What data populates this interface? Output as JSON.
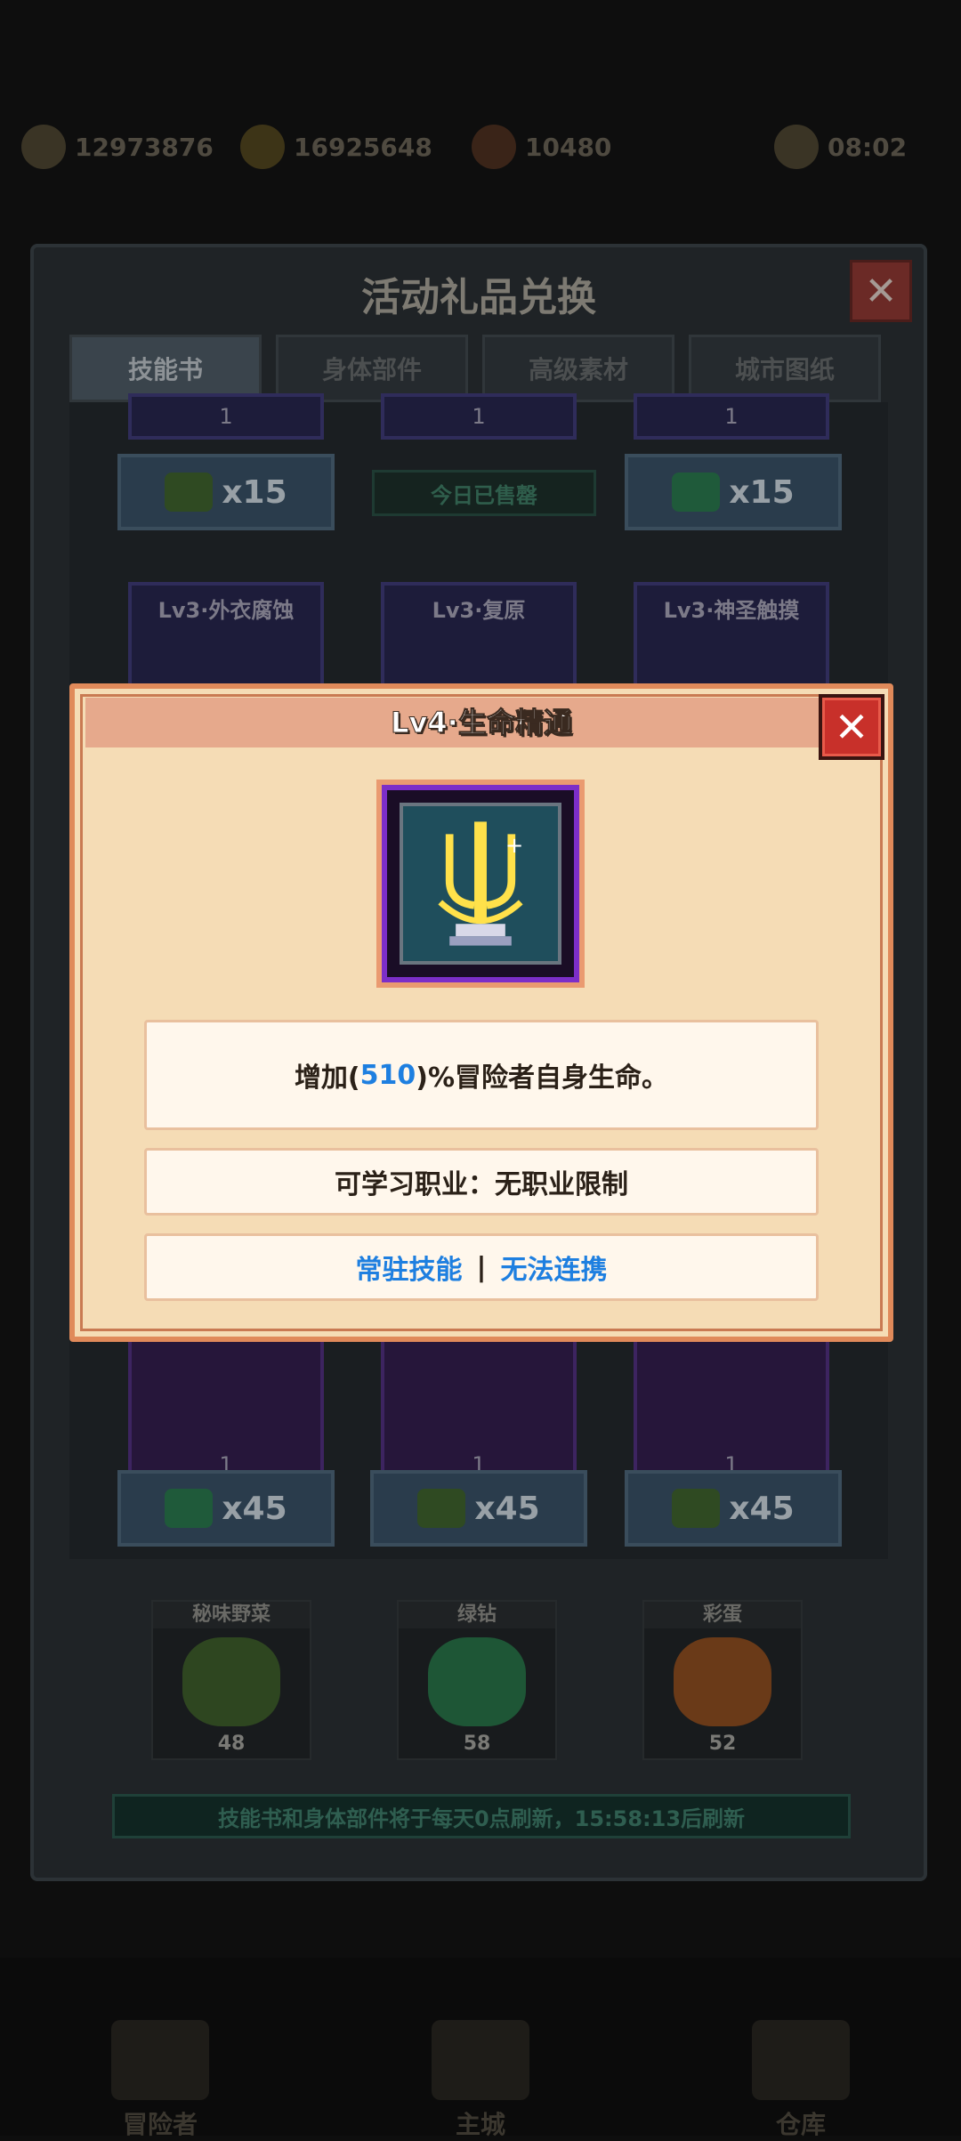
{
  "status_bar": {
    "res1_value": "12973876",
    "res2_value": "16925648",
    "res3_value": "10480",
    "timer": "08:02"
  },
  "panel": {
    "title": "活动礼品兑换",
    "tabs": [
      {
        "label": "技能书",
        "active": true
      },
      {
        "label": "身体部件",
        "active": false
      },
      {
        "label": "高级素材",
        "active": false
      },
      {
        "label": "城市图纸",
        "active": false
      }
    ],
    "row1_prices": [
      {
        "icon": "wild-vegetable-icon",
        "cost": "x15"
      },
      {
        "sold_out": "今日已售罄"
      },
      {
        "icon": "green-diamond-icon",
        "cost": "x15"
      }
    ],
    "row2_cards": [
      {
        "name": "Lv3·外衣腐蚀"
      },
      {
        "name": "Lv3·复原"
      },
      {
        "name": "Lv3·神圣触摸"
      }
    ],
    "row3_cards": [
      {
        "count": "1"
      },
      {
        "count": "1"
      },
      {
        "count": "1"
      }
    ],
    "row3_prices": [
      {
        "icon": "green-diamond-icon",
        "cost": "x45"
      },
      {
        "icon": "wild-vegetable-icon",
        "cost": "x45"
      },
      {
        "icon": "wild-vegetable-icon",
        "cost": "x45"
      }
    ],
    "top_counts": [
      "1",
      "1",
      "1"
    ],
    "inventory": [
      {
        "label": "秘味野菜",
        "count": "48",
        "icon": "wild-vegetable-icon"
      },
      {
        "label": "绿钻",
        "count": "58",
        "icon": "green-diamond-icon"
      },
      {
        "label": "彩蛋",
        "count": "52",
        "icon": "easter-egg-icon"
      }
    ],
    "refresh_notice": "技能书和身体部件将于每天0点刷新，15:58:13后刷新"
  },
  "popup": {
    "title": "Lv4·生命精通",
    "skill_icon": "life-mastery-trident-icon",
    "desc_prefix": "增加(",
    "desc_value": "510",
    "desc_suffix": ")%冒险者自身生命。",
    "class_req": "可学习职业：无职业限制",
    "tag1": "常驻技能",
    "tag_sep": "|",
    "tag2": "无法连携",
    "close_glyph": "✕"
  },
  "bottom_nav": [
    {
      "label": "冒险者"
    },
    {
      "label": "主城"
    },
    {
      "label": "仓库"
    }
  ],
  "colors": {
    "popup_bg": "#f5dcb5",
    "popup_border": "#e08a5a",
    "accent_blue": "#1e7fe0",
    "close_red": "#c8302a"
  }
}
